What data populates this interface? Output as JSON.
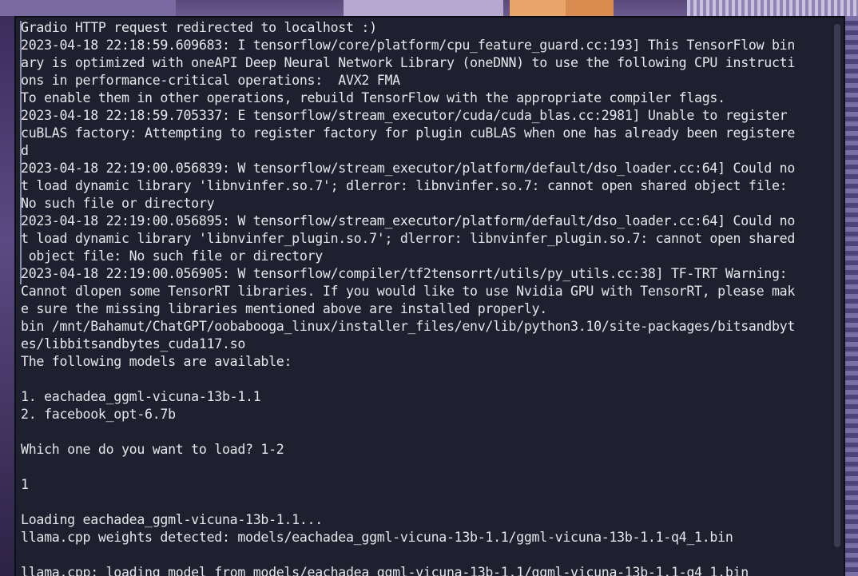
{
  "terminal": {
    "lines": [
      "Gradio HTTP request redirected to localhost :)",
      "2023-04-18 22:18:59.609683: I tensorflow/core/platform/cpu_feature_guard.cc:193] This TensorFlow bin",
      "ary is optimized with oneAPI Deep Neural Network Library (oneDNN) to use the following CPU instructi",
      "ons in performance-critical operations:  AVX2 FMA",
      "To enable them in other operations, rebuild TensorFlow with the appropriate compiler flags.",
      "2023-04-18 22:18:59.705337: E tensorflow/stream_executor/cuda/cuda_blas.cc:2981] Unable to register",
      "cuBLAS factory: Attempting to register factory for plugin cuBLAS when one has already been registere",
      "d",
      "2023-04-18 22:19:00.056839: W tensorflow/stream_executor/platform/default/dso_loader.cc:64] Could no",
      "t load dynamic library 'libnvinfer.so.7'; dlerror: libnvinfer.so.7: cannot open shared object file:",
      "No such file or directory",
      "2023-04-18 22:19:00.056895: W tensorflow/stream_executor/platform/default/dso_loader.cc:64] Could no",
      "t load dynamic library 'libnvinfer_plugin.so.7'; dlerror: libnvinfer_plugin.so.7: cannot open shared",
      " object file: No such file or directory",
      "2023-04-18 22:19:00.056905: W tensorflow/compiler/tf2tensorrt/utils/py_utils.cc:38] TF-TRT Warning:",
      "Cannot dlopen some TensorRT libraries. If you would like to use Nvidia GPU with TensorRT, please mak",
      "e sure the missing libraries mentioned above are installed properly.",
      "bin /mnt/Bahamut/ChatGPT/oobabooga_linux/installer_files/env/lib/python3.10/site-packages/bitsandbyt",
      "es/libbitsandbytes_cuda117.so",
      "The following models are available:",
      "",
      "1. eachadea_ggml-vicuna-13b-1.1",
      "2. facebook_opt-6.7b",
      "",
      "Which one do you want to load? 1-2",
      "",
      "1",
      "",
      "Loading eachadea_ggml-vicuna-13b-1.1...",
      "llama.cpp weights detected: models/eachadea_ggml-vicuna-13b-1.1/ggml-vicuna-13b-1.1-q4_1.bin",
      "",
      "llama.cpp: loading model from models/eachadea_ggml-vicuna-13b-1.1/ggml-vicuna-13b-1.1-q4_1.bin"
    ]
  },
  "colors": {
    "terminal_bg": "#1e2030",
    "terminal_fg": "#e6e6ea"
  }
}
